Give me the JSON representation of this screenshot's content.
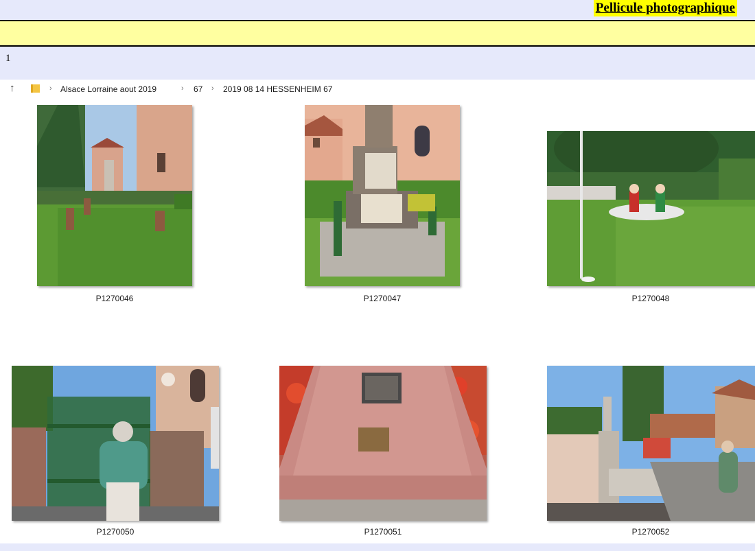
{
  "page": {
    "title": "Pellicule photographique",
    "number": "1"
  },
  "explorer": {
    "breadcrumb": [
      "Alsace Lorraine aout 2019",
      "67",
      "2019 08 14 HESSENHEIM 67"
    ],
    "photos": [
      {
        "name": "P1270046"
      },
      {
        "name": "P1270047"
      },
      {
        "name": "P1270048"
      },
      {
        "name": "P1270050"
      },
      {
        "name": "P1270051"
      },
      {
        "name": "P1270052"
      }
    ]
  },
  "colors": {
    "title_highlight": "#ffff00",
    "band_yellow": "#ffffa0",
    "band_lavender": "#e6e9fb"
  }
}
